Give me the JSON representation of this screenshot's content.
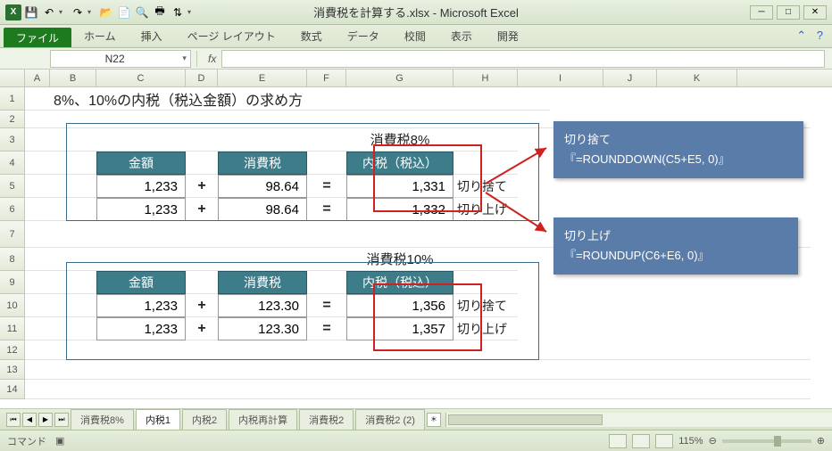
{
  "window": {
    "title": "消費税を計算する.xlsx  -  Microsoft Excel"
  },
  "ribbon": {
    "file": "ファイル",
    "tabs": [
      "ホーム",
      "挿入",
      "ページ レイアウト",
      "数式",
      "データ",
      "校閲",
      "表示",
      "開発"
    ]
  },
  "formula_bar": {
    "name_box": "N22",
    "fx": "fx",
    "formula": ""
  },
  "columns": [
    "A",
    "B",
    "C",
    "D",
    "E",
    "F",
    "G",
    "H",
    "I",
    "J",
    "K"
  ],
  "rows": [
    "1",
    "2",
    "3",
    "4",
    "5",
    "6",
    "7",
    "8",
    "9",
    "10",
    "11",
    "12",
    "13",
    "14"
  ],
  "content": {
    "title": "8%、10%の内税（税込金額）の求め方",
    "section1": {
      "heading": "消費税8%"
    },
    "section2": {
      "heading": "消費税10%"
    },
    "headers": {
      "amount": "金額",
      "tax": "消費税",
      "incl": "内税（税込）"
    },
    "ops": {
      "plus": "+",
      "eq": "="
    },
    "labels": {
      "down": "切り捨て",
      "up": "切り上げ"
    },
    "r5": {
      "amount": "1,233",
      "tax": "98.64",
      "incl": "1,331"
    },
    "r6": {
      "amount": "1,233",
      "tax": "98.64",
      "incl": "1,332"
    },
    "r10": {
      "amount": "1,233",
      "tax": "123.30",
      "incl": "1,356"
    },
    "r11": {
      "amount": "1,233",
      "tax": "123.30",
      "incl": "1,357"
    }
  },
  "callouts": {
    "c1": {
      "title": "切り捨て",
      "formula": "『=ROUNDDOWN(C5+E5, 0)』"
    },
    "c2": {
      "title": "切り上げ",
      "formula": "『=ROUNDUP(C6+E6, 0)』"
    }
  },
  "sheet_tabs": [
    "消費税8%",
    "内税1",
    "内税2",
    "内税再計算",
    "消費税2",
    "消費税2 (2)"
  ],
  "active_sheet": "内税1",
  "statusbar": {
    "mode": "コマンド",
    "zoom": "115%"
  }
}
